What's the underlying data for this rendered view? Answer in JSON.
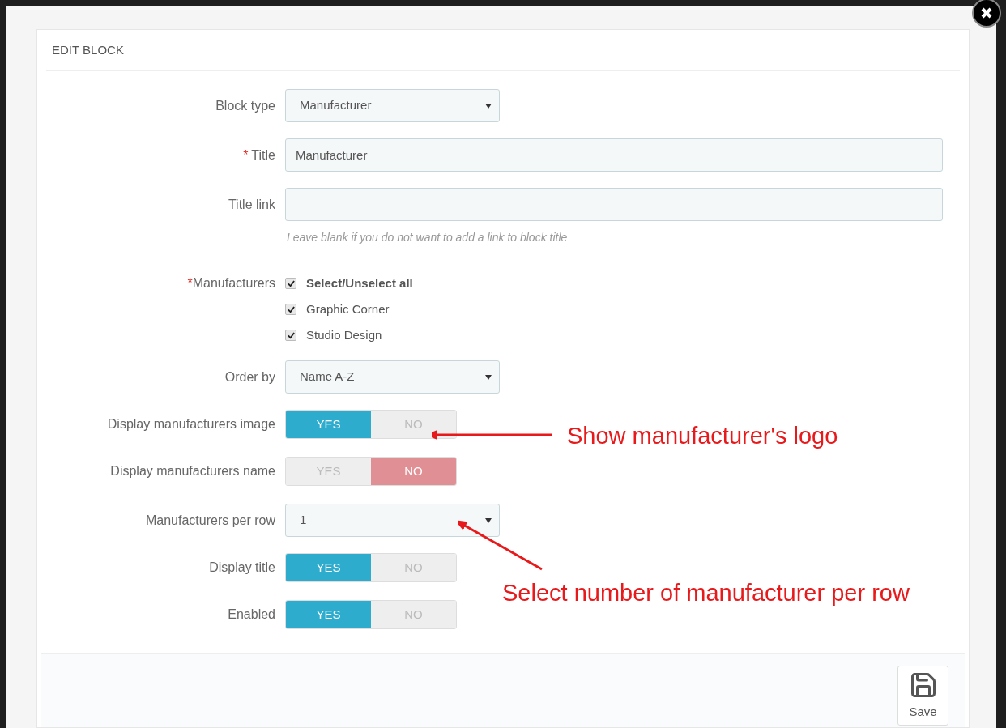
{
  "panel": {
    "title": "EDIT BLOCK"
  },
  "fields": [
    {
      "kind": "select",
      "label": "Block type",
      "value": "Manufacturer"
    },
    {
      "kind": "text",
      "label": "Title",
      "asterisk": "*",
      "value": "Manufacturer"
    },
    {
      "kind": "text",
      "label": "Title link",
      "hint": "Leave blank if you do not want to add a link to block title"
    },
    {
      "kind": "checkboxes",
      "label": "Manufacturers",
      "asterisk": "*",
      "options": [
        {
          "label": "Select/Unselect all",
          "checked": true
        },
        {
          "label": "Graphic Corner",
          "checked": true
        },
        {
          "label": "Studio Design",
          "checked": true
        }
      ]
    },
    {
      "kind": "select",
      "label": "Order by",
      "value": "Name A-Z"
    },
    {
      "kind": "toggle",
      "label": "Display manufacturers image",
      "options": [
        {
          "label": "YES",
          "selected": true
        },
        {
          "label": "NO",
          "selected": false
        }
      ]
    },
    {
      "kind": "toggle",
      "label": "Display manufacturers name",
      "options": [
        {
          "label": "YES",
          "selected": false
        },
        {
          "label": "NO",
          "selected": true
        }
      ]
    },
    {
      "kind": "select",
      "label": "Manufacturers per row",
      "value": "1"
    },
    {
      "kind": "toggle",
      "label": "Display title",
      "options": [
        {
          "label": "YES",
          "selected": true
        },
        {
          "label": "NO",
          "selected": false
        }
      ]
    },
    {
      "kind": "toggle",
      "label": "Enabled",
      "options": [
        {
          "label": "YES",
          "selected": true
        },
        {
          "label": "NO",
          "selected": false
        }
      ]
    }
  ],
  "footer": {
    "save": "Save"
  },
  "annotations": [
    {
      "text": "Show manufacturer's logo"
    },
    {
      "text": "Select number of manufacturer per row"
    }
  ]
}
